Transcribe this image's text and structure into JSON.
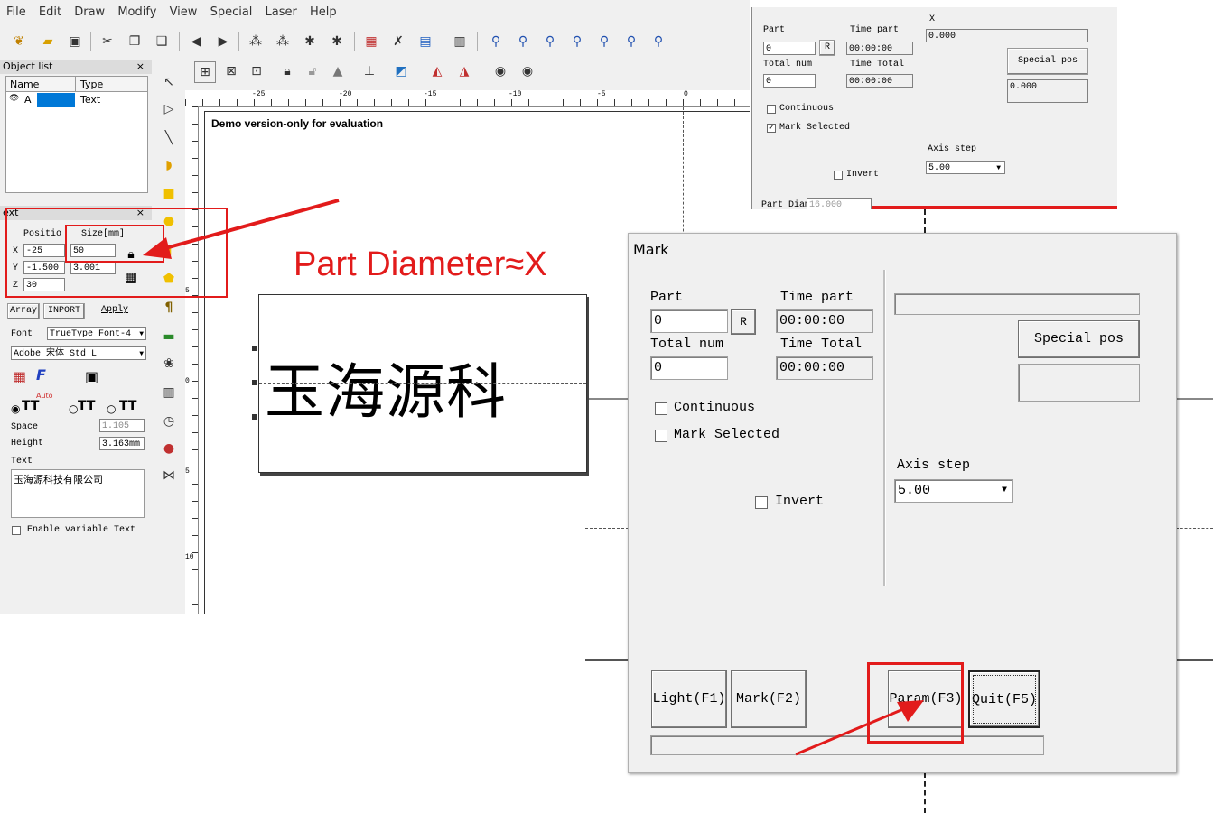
{
  "menu": [
    "File",
    "Edit",
    "Draw",
    "Modify",
    "View",
    "Special",
    "Laser",
    "Help"
  ],
  "toolbar_icons": [
    "save-icon",
    "folder-icon",
    "disk-icon",
    "cut-icon",
    "copy-icon",
    "paste-icon",
    "back-icon",
    "forward-icon",
    "node-icon",
    "node2-icon",
    "node3-icon",
    "node4-icon",
    "hatch-icon",
    "tools-icon",
    "grid-icon",
    "barcode-icon",
    "zoom-icon",
    "zoom-in-icon",
    "zoom-plus-icon",
    "zoom-minus-icon",
    "zoom-all-icon",
    "zoom-fit-icon",
    "zoom-select-icon"
  ],
  "object_list": {
    "title": "Object list",
    "close": "×",
    "col_name": "Name",
    "col_type": "Type",
    "row_name": "A",
    "row_type": "Text"
  },
  "text_panel": {
    "title": "ext",
    "close": "×",
    "position_label": "Positio",
    "size_label": "Size[mm]",
    "x_label": "X",
    "x_pos": "-25",
    "x_size": "50",
    "y_label": "Y",
    "y_pos": "-1.500",
    "y_size": "3.001",
    "z_label": "Z",
    "z_pos": "30",
    "tab_array": "Array",
    "tab_input": "INPORT",
    "tab_apply": "Apply",
    "font_label": "Font",
    "font_type": "TrueType Font-4",
    "font_name": "Adobe 宋体 Std L",
    "auto_label": "Auto",
    "space_label": "Space",
    "space_value": "1.105",
    "height_label": "Height",
    "height_value": "3.163mm",
    "text_label": "Text",
    "text_value": "玉海源科技有限公司",
    "enable_var": "Enable variable Text"
  },
  "canvas": {
    "demo_text": "Demo version-only for evaluation",
    "preview_text": "玉海源科",
    "ruler_top": [
      "-25",
      "-20",
      "-15",
      "-10",
      "-5",
      "0"
    ],
    "ruler_left": [
      "5",
      "0",
      "5",
      "10"
    ]
  },
  "annotation": {
    "text": "Part Diameter≈X",
    "color": "#e21b1b"
  },
  "small_dialog": {
    "part_label": "Part",
    "part_value": "0",
    "r_button": "R",
    "time_part_label": "Time part",
    "time_part_value": "00:00:00",
    "total_num_label": "Total num",
    "total_num_value": "0",
    "time_total_label": "Time Total",
    "time_total_value": "00:00:00",
    "continuous": "Continuous",
    "mark_selected": "Mark Selected",
    "invert": "Invert",
    "x_label": "X",
    "x_value": "0.000",
    "special_pos": "Special pos",
    "y_value": "0.000",
    "axis_step_label": "Axis step",
    "axis_step_value": "5.00",
    "part_diameter_label": "Part Diameter",
    "part_diameter_value": "16.000"
  },
  "mark_dialog": {
    "title": "Mark",
    "part_label": "Part",
    "part_value": "0",
    "r_button": "R",
    "time_part_label": "Time part",
    "time_part_value": "00:00:00",
    "total_num_label": "Total num",
    "total_num_value": "0",
    "time_total_label": "Time Total",
    "time_total_value": "00:00:00",
    "continuous": "Continuous",
    "mark_selected": "Mark Selected",
    "invert": "Invert",
    "special_pos": "Special pos",
    "axis_step_label": "Axis step",
    "axis_step_value": "5.00",
    "light_button": "Light(F1)",
    "mark_button": "Mark(F2)",
    "param_button": "Param(F3)",
    "quit_button": "Quit(F5)"
  }
}
